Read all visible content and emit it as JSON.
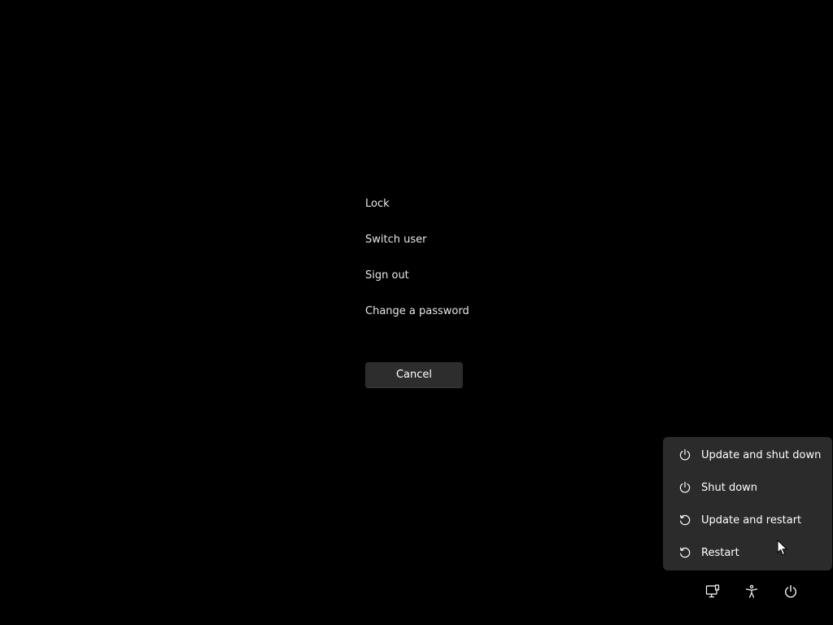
{
  "security_options": {
    "items": [
      {
        "label": "Lock"
      },
      {
        "label": "Switch user"
      },
      {
        "label": "Sign out"
      },
      {
        "label": "Change a password"
      }
    ],
    "cancel_label": "Cancel"
  },
  "power_menu": {
    "items": [
      {
        "label": "Update and shut down",
        "icon": "power-icon"
      },
      {
        "label": "Shut down",
        "icon": "power-icon"
      },
      {
        "label": "Update and restart",
        "icon": "restart-icon"
      },
      {
        "label": "Restart",
        "icon": "restart-icon"
      }
    ]
  },
  "tray": {
    "icons": [
      "network-icon",
      "accessibility-icon",
      "power-icon"
    ]
  },
  "colors": {
    "background": "#000000",
    "menu_background": "#2b2b2b",
    "button_background": "#2d2d2d",
    "text": "#ffffff"
  }
}
